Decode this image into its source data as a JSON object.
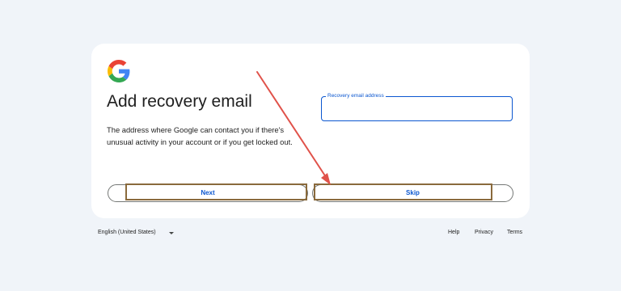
{
  "card": {
    "logo_icon": "google-g-icon",
    "title": "Add recovery email",
    "description": "The address where Google can contact you if there's unusual activity in your account or if you get locked out.",
    "recovery_email_field": {
      "label": "Recovery email address",
      "value": ""
    },
    "buttons": {
      "next_label": "Next",
      "skip_label": "Skip"
    }
  },
  "annotation": {
    "arrow_color": "#e0524a",
    "highlight_color": "#8a6a3c"
  },
  "footer": {
    "language": "English (United States)",
    "links": {
      "help": "Help",
      "privacy": "Privacy",
      "terms": "Terms"
    }
  },
  "colors": {
    "background": "#f0f4f9",
    "accent": "#0b57d0"
  }
}
